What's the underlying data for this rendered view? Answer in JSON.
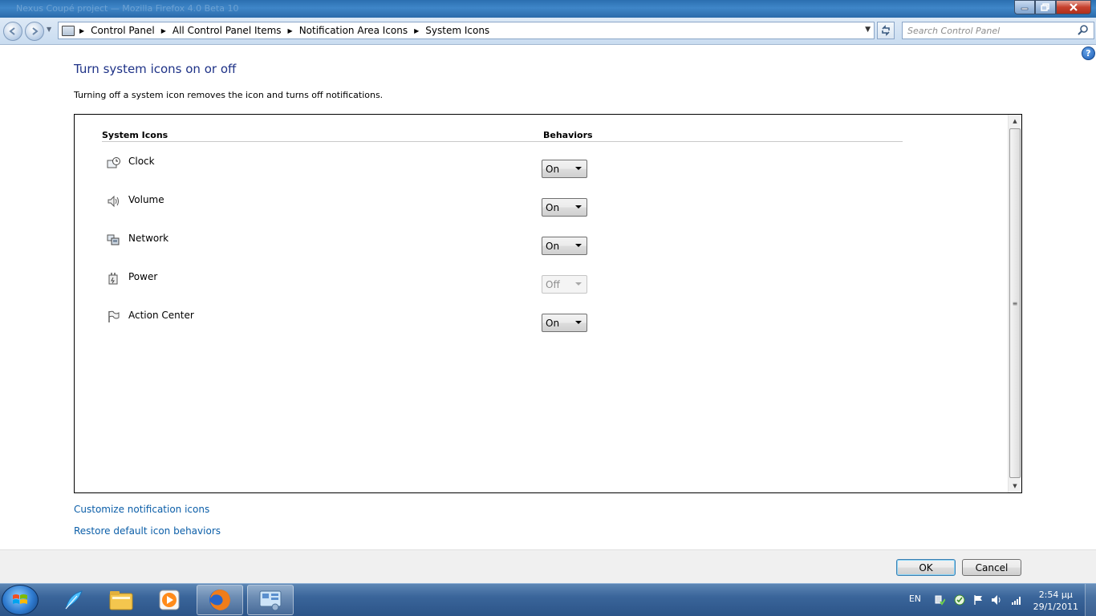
{
  "window": {
    "ghost_title": "Nexus Coupé project — Mozilla Firefox 4.0 Beta 10",
    "min_glyph": "0",
    "max_glyph": "1",
    "close_glyph": "r"
  },
  "nav": {
    "back_glyph": "◄",
    "forward_glyph": "►",
    "dropdown_glyph": "▼",
    "breadcrumb": [
      "Control Panel",
      "All Control Panel Items",
      "Notification Area Icons",
      "System Icons"
    ],
    "sep_glyph": "▶",
    "refresh_glyph": "⟳",
    "search_placeholder": "Search Control Panel",
    "search_glyph": "⚲"
  },
  "help_glyph": "?",
  "page": {
    "title": "Turn system icons on or off",
    "description": "Turning off a system icon removes the icon and turns off notifications."
  },
  "table": {
    "col_system": "System Icons",
    "col_behaviors": "Behaviors",
    "rows": [
      {
        "label": "Clock",
        "value": "On",
        "icon": "clock-icon"
      },
      {
        "label": "Volume",
        "value": "On",
        "icon": "volume-icon"
      },
      {
        "label": "Network",
        "value": "On",
        "icon": "network-icon"
      },
      {
        "label": "Power",
        "value": "Off",
        "icon": "power-icon",
        "disabled": true
      },
      {
        "label": "Action Center",
        "value": "On",
        "icon": "action-center-flag-icon"
      }
    ],
    "scroll_up_glyph": "▲",
    "scroll_down_glyph": "▼",
    "thumb_grip": "≡"
  },
  "links": {
    "customize": "Customize notification icons",
    "restore": "Restore default icon behaviors"
  },
  "buttons": {
    "ok": "OK",
    "cancel": "Cancel"
  },
  "taskbar": {
    "language": "EN",
    "time": "2:54 μμ",
    "date": "29/1/2011"
  },
  "colors": {
    "title_link": "#1e3287",
    "link": "#0b5ea8",
    "taskbar": "#3a659a"
  }
}
